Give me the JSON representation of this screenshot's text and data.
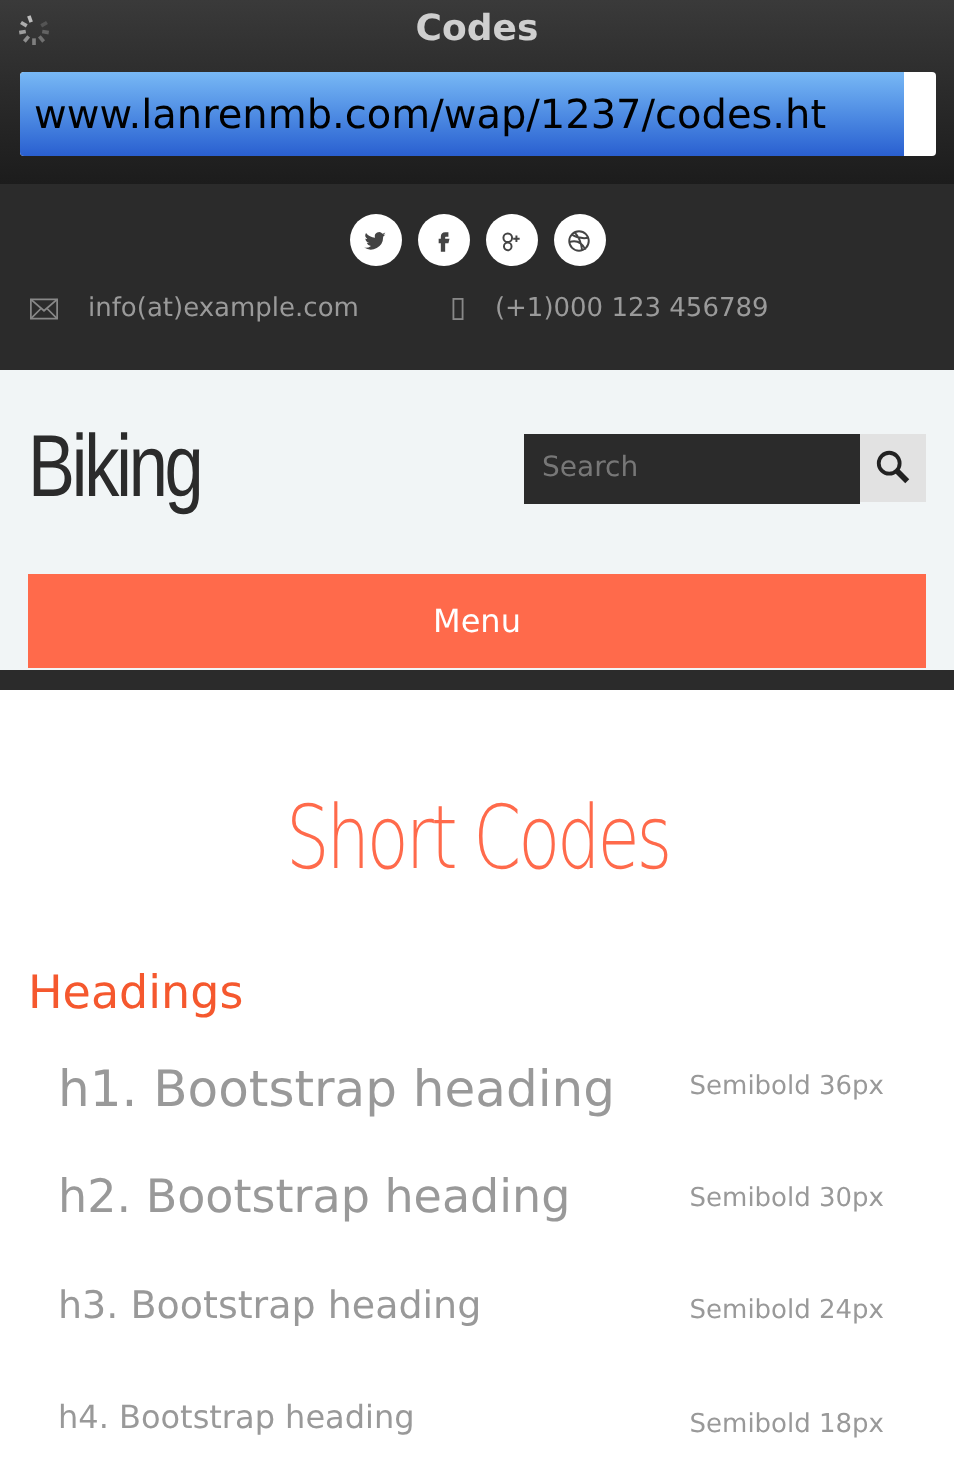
{
  "browser": {
    "title": "Codes",
    "url": "www.lanrenmb.com/wap/1237/codes.ht"
  },
  "social": [
    {
      "kind": "twitter"
    },
    {
      "kind": "facebook"
    },
    {
      "kind": "googleplus"
    },
    {
      "kind": "dribbble"
    }
  ],
  "contact": {
    "email": "info(at)example.com",
    "phone": "(+1)000 123 456789"
  },
  "header": {
    "logo": "Biking",
    "search": {
      "placeholder": "Search"
    },
    "menu": "Menu"
  },
  "page_title": "Short Codes",
  "section": "Headings",
  "headings": [
    {
      "text": "h1. Bootstrap heading",
      "note": "Semibold 36px",
      "kind": "h1"
    },
    {
      "text": "h2. Bootstrap heading",
      "note": "Semibold 30px",
      "kind": "h2"
    },
    {
      "text": "h3. Bootstrap heading",
      "note": "Semibold 24px",
      "kind": "h3"
    },
    {
      "text": "h4. Bootstrap heading",
      "note": "Semibold 18px",
      "kind": "h4"
    }
  ]
}
